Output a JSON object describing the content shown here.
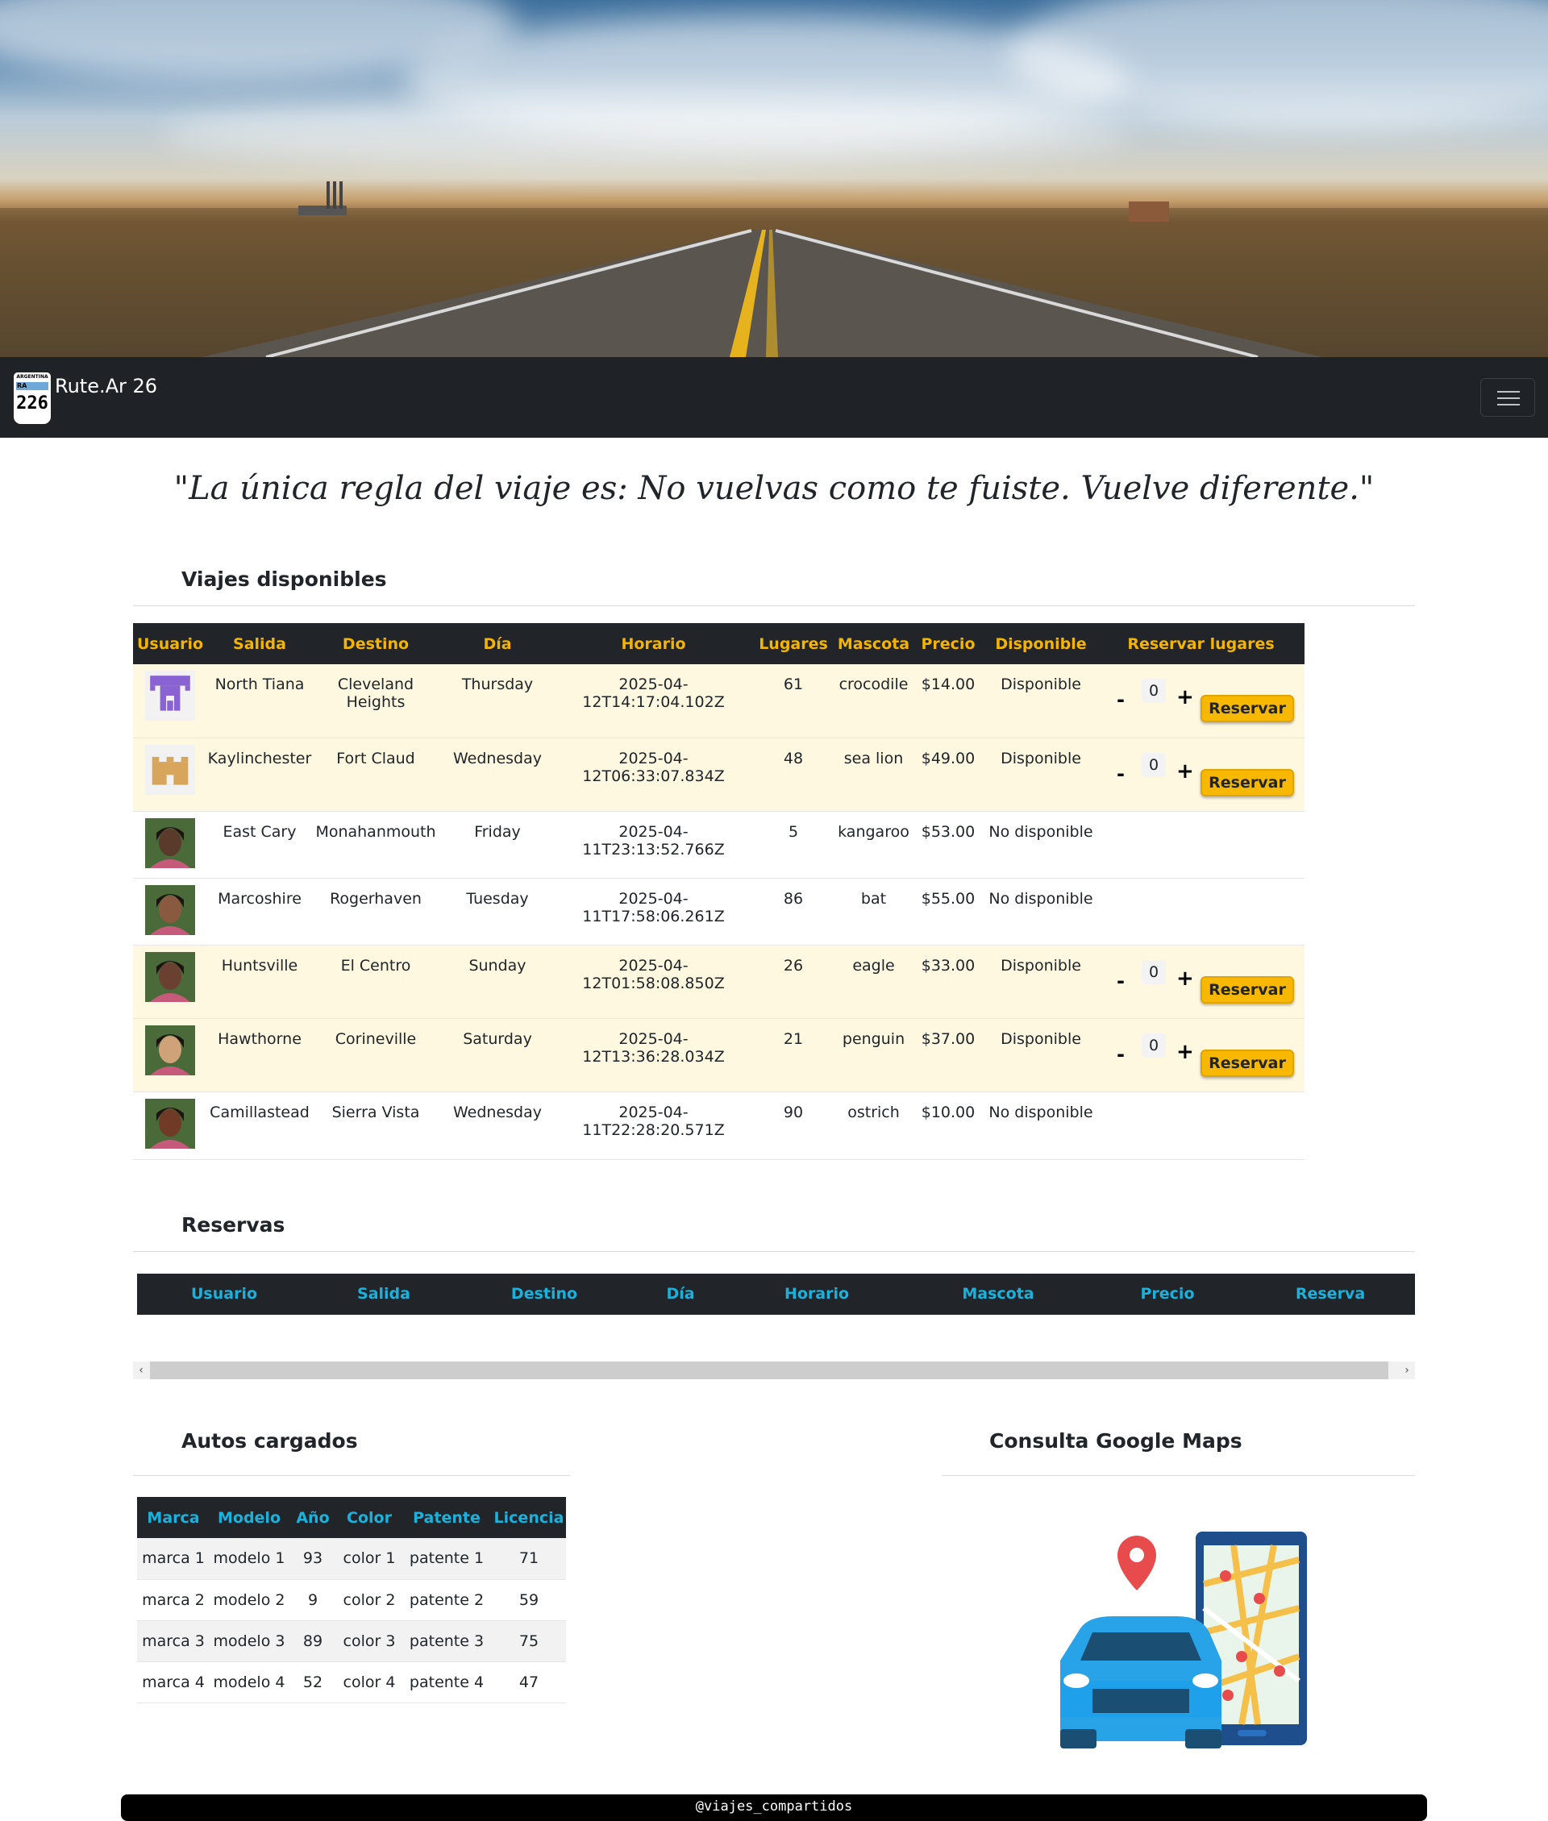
{
  "navbar": {
    "brand_text": "Rute.Ar 26",
    "logo": {
      "top_text": "ARGENTINA",
      "band_text": "RA",
      "number": "226"
    },
    "menu_icon": "hamburger-icon"
  },
  "quote": "\"La única regla del viaje es: No vuelvas como te fuiste. Vuelve diferente.\"",
  "trips": {
    "title": "Viajes disponibles",
    "columns": [
      "Usuario",
      "Salida",
      "Destino",
      "Día",
      "Horario",
      "Lugares",
      "Mascota",
      "Precio",
      "Disponible",
      "Reservar lugares"
    ],
    "reserve_label": "Reservar",
    "minus_label": "-",
    "plus_label": "+",
    "rows": [
      {
        "avatar": "identicon-purple",
        "salida": "North Tiana",
        "destino": "Cleveland Heights",
        "dia": "Thursday",
        "horario": "2025-04-12T14:17:04.102Z",
        "lugares": "61",
        "mascota": "crocodile",
        "precio": "$14.00",
        "disponible": "Disponible",
        "qty": "0",
        "available": true
      },
      {
        "avatar": "identicon-tan",
        "salida": "Kaylinchester",
        "destino": "Fort Claud",
        "dia": "Wednesday",
        "horario": "2025-04-12T06:33:07.834Z",
        "lugares": "48",
        "mascota": "sea lion",
        "precio": "$49.00",
        "disponible": "Disponible",
        "qty": "0",
        "available": true
      },
      {
        "avatar": "photo-woman",
        "salida": "East Cary",
        "destino": "Monahanmouth",
        "dia": "Friday",
        "horario": "2025-04-11T23:13:52.766Z",
        "lugares": "5",
        "mascota": "kangaroo",
        "precio": "$53.00",
        "disponible": "No disponible",
        "qty": "",
        "available": false
      },
      {
        "avatar": "photo-woman",
        "salida": "Marcoshire",
        "destino": "Rogerhaven",
        "dia": "Tuesday",
        "horario": "2025-04-11T17:58:06.261Z",
        "lugares": "86",
        "mascota": "bat",
        "precio": "$55.00",
        "disponible": "No disponible",
        "qty": "",
        "available": false
      },
      {
        "avatar": "photo-woman",
        "salida": "Huntsville",
        "destino": "El Centro",
        "dia": "Sunday",
        "horario": "2025-04-12T01:58:08.850Z",
        "lugares": "26",
        "mascota": "eagle",
        "precio": "$33.00",
        "disponible": "Disponible",
        "qty": "0",
        "available": true
      },
      {
        "avatar": "photo-woman",
        "salida": "Hawthorne",
        "destino": "Corineville",
        "dia": "Saturday",
        "horario": "2025-04-12T13:36:28.034Z",
        "lugares": "21",
        "mascota": "penguin",
        "precio": "$37.00",
        "disponible": "Disponible",
        "qty": "0",
        "available": true
      },
      {
        "avatar": "photo-woman",
        "salida": "Camillastead",
        "destino": "Sierra Vista",
        "dia": "Wednesday",
        "horario": "2025-04-11T22:28:20.571Z",
        "lugares": "90",
        "mascota": "ostrich",
        "precio": "$10.00",
        "disponible": "No disponible",
        "qty": "",
        "available": false
      }
    ]
  },
  "reservas": {
    "title": "Reservas",
    "columns": [
      "Usuario",
      "Salida",
      "Destino",
      "Día",
      "Horario",
      "Mascota",
      "Precio",
      "Reserva"
    ]
  },
  "cars": {
    "title": "Autos cargados",
    "columns": [
      "Marca",
      "Modelo",
      "Año",
      "Color",
      "Patente",
      "Licencia"
    ],
    "rows": [
      [
        "marca 1",
        "modelo 1",
        "93",
        "color 1",
        "patente 1",
        "71"
      ],
      [
        "marca 2",
        "modelo 2",
        "9",
        "color 2",
        "patente 2",
        "59"
      ],
      [
        "marca 3",
        "modelo 3",
        "89",
        "color 3",
        "patente 3",
        "75"
      ],
      [
        "marca 4",
        "modelo 4",
        "52",
        "color 4",
        "patente 4",
        "47"
      ]
    ]
  },
  "maps": {
    "title": "Consulta Google Maps",
    "illustration": "car-phone-map-illustration"
  },
  "footer": {
    "text": "@viajes_compartidos"
  },
  "colors": {
    "navbar": "#1f2327",
    "trip_header_text": "#f4b400",
    "reserve_button": "#f9b800",
    "table_header_text": "#1ab2dc",
    "available_row": "#fff8e1"
  }
}
